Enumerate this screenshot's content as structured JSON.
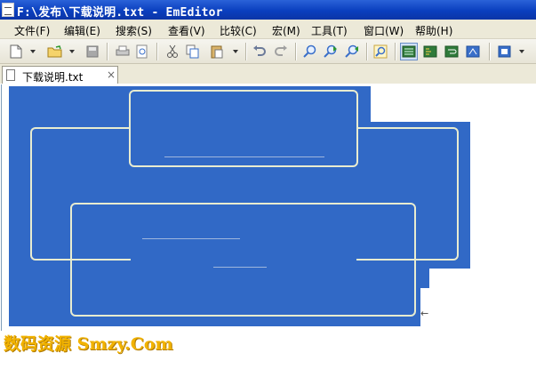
{
  "window": {
    "title": "F:\\发布\\下载说明.txt - EmEditor"
  },
  "menu": [
    {
      "label": "文件(F)"
    },
    {
      "label": "编辑(E)"
    },
    {
      "label": "搜索(S)"
    },
    {
      "label": "查看(V)"
    },
    {
      "label": "比较(C)"
    },
    {
      "label": "宏(M)"
    },
    {
      "label": "工具(T)"
    },
    {
      "label": "窗口(W)"
    },
    {
      "label": "帮助(H)"
    }
  ],
  "toolbar": {
    "icons": [
      "new-file-icon",
      "open-folder-icon",
      "save-icon",
      "print-icon",
      "print-preview-icon",
      "cut-icon",
      "copy-icon",
      "paste-icon",
      "undo-icon",
      "redo-icon",
      "find-icon",
      "find-next-icon",
      "find-prev-icon",
      "highlight-icon",
      "view-icon",
      "outline-icon",
      "wrap-icon",
      "macro-icon",
      "customize-icon"
    ]
  },
  "tab": {
    "label": "下载说明.txt",
    "close": "×"
  },
  "watermark": {
    "text": "数码资源 Smzy.Com"
  }
}
